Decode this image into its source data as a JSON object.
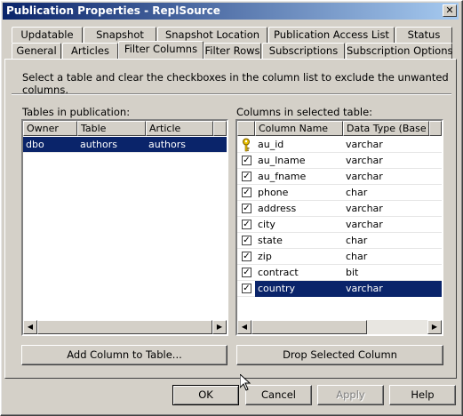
{
  "window": {
    "title": "Publication Properties - ReplSource",
    "close_glyph": "✕"
  },
  "tabs_row1": [
    "Updatable",
    "Snapshot",
    "Snapshot Location",
    "Publication Access List",
    "Status"
  ],
  "tabs_row2": [
    "General",
    "Articles",
    "Filter Columns",
    "Filter Rows",
    "Subscriptions",
    "Subscription Options"
  ],
  "active_tab": "Filter Columns",
  "instruction": "Select a table and clear the checkboxes in the column list to exclude the unwanted columns.",
  "tables": {
    "label": "Tables in publication:",
    "headers": [
      "Owner",
      "Table",
      "Article"
    ],
    "rows": [
      {
        "owner": "dbo",
        "table": "authors",
        "article": "authors",
        "selected": true
      }
    ]
  },
  "columns": {
    "label": "Columns in selected table:",
    "headers": [
      "Column Name",
      "Data Type (Base ..."
    ],
    "rows": [
      {
        "name": "au_id",
        "type": "varchar",
        "key": true,
        "checked": true
      },
      {
        "name": "au_lname",
        "type": "varchar",
        "checked": true
      },
      {
        "name": "au_fname",
        "type": "varchar",
        "checked": true
      },
      {
        "name": "phone",
        "type": "char",
        "checked": true
      },
      {
        "name": "address",
        "type": "varchar",
        "checked": true
      },
      {
        "name": "city",
        "type": "varchar",
        "checked": true
      },
      {
        "name": "state",
        "type": "char",
        "checked": true
      },
      {
        "name": "zip",
        "type": "char",
        "checked": true
      },
      {
        "name": "contract",
        "type": "bit",
        "checked": true
      },
      {
        "name": "country",
        "type": "varchar",
        "checked": true,
        "selected": true
      }
    ]
  },
  "buttons": {
    "add_column": "Add Column to Table...",
    "drop_column": "Drop Selected Column",
    "ok": "OK",
    "cancel": "Cancel",
    "apply": "Apply",
    "help": "Help"
  },
  "icons": {
    "key": "key-icon",
    "check": "✓",
    "scroll_left": "◀",
    "scroll_right": "▶"
  },
  "colors": {
    "title_start": "#0a246a",
    "title_end": "#a6caf0",
    "selection": "#0a246a",
    "face": "#d4d0c8"
  }
}
